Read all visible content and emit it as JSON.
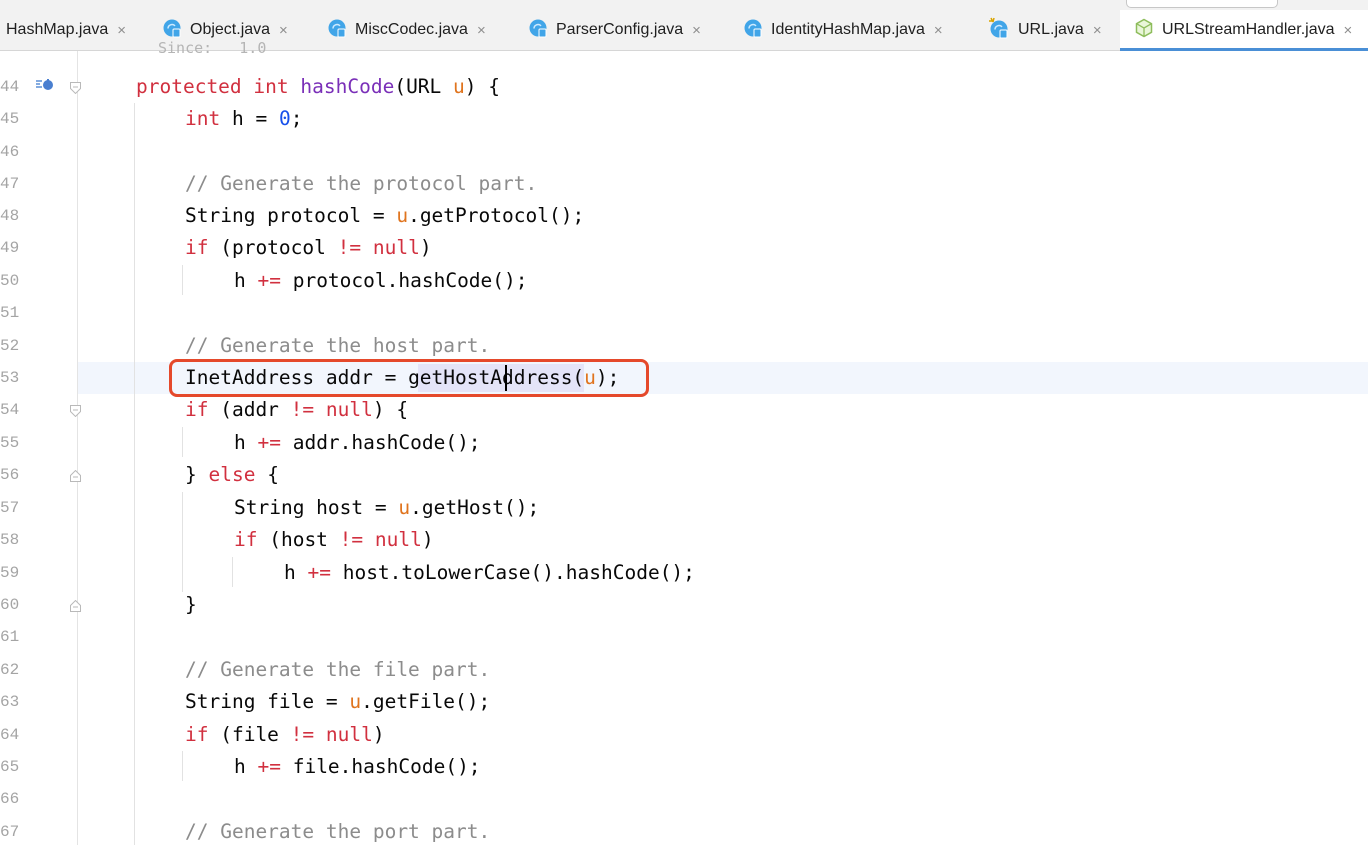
{
  "tabs": [
    {
      "label": "HashMap.java",
      "icon": "java-class-icon"
    },
    {
      "label": "Object.java",
      "icon": "java-class-icon"
    },
    {
      "label": "MiscCodec.java",
      "icon": "java-class-icon"
    },
    {
      "label": "ParserConfig.java",
      "icon": "java-class-icon"
    },
    {
      "label": "IdentityHashMap.java",
      "icon": "java-class-icon"
    },
    {
      "label": "URL.java",
      "icon": "java-final-class-icon"
    },
    {
      "label": "URLStreamHandler.java",
      "icon": "java-abstract-class-icon",
      "active": true
    }
  ],
  "close_glyph": "×",
  "partial_top_text": "Since:   1.0",
  "line_numbers": [
    "44",
    "45",
    "46",
    "47",
    "48",
    "49",
    "50",
    "51",
    "52",
    "53",
    "54",
    "55",
    "56",
    "57",
    "58",
    "59",
    "60",
    "61",
    "62",
    "63",
    "64",
    "65",
    "66",
    "67"
  ],
  "code": {
    "l44": {
      "kw": "protected",
      "type": "int",
      "name": "hashCode",
      "pre_param": "(URL ",
      "param": "u",
      "post": ") {"
    },
    "l45": {
      "type": "int",
      "mid": " h = ",
      "num": "0",
      "post": ";"
    },
    "l47": "// Generate the protocol part.",
    "l48": {
      "a": "String protocol = ",
      "p": "u",
      "b": ".getProtocol();"
    },
    "l49": {
      "kw": "if",
      "a": " (protocol ",
      "op": "!=",
      "b": " ",
      "null": "null",
      "c": ")"
    },
    "l50": {
      "a": "h ",
      "op": "+=",
      "b": " protocol.hashCode();"
    },
    "l52": "// Generate the host part.",
    "l53": {
      "a": "InetAddress addr = ",
      "sel1": "getHost",
      "sel2": "Address(",
      "p": "u",
      "b": ");"
    },
    "l54": {
      "kw": "if",
      "a": " (addr ",
      "op": "!=",
      "b": " ",
      "null": "null",
      "c": ") {"
    },
    "l55": {
      "a": "h ",
      "op": "+=",
      "b": " addr.hashCode();"
    },
    "l56": {
      "a": "} ",
      "kw": "else",
      "b": " {"
    },
    "l57": {
      "a": "String host = ",
      "p": "u",
      "b": ".getHost();"
    },
    "l58": {
      "kw": "if",
      "a": " (host ",
      "op": "!=",
      "b": " ",
      "null": "null",
      "c": ")"
    },
    "l59": {
      "a": "h ",
      "op": "+=",
      "b": " host.toLowerCase().hashCode();"
    },
    "l60": "}",
    "l62": "// Generate the file part.",
    "l63": {
      "a": "String file = ",
      "p": "u",
      "b": ".getFile();"
    },
    "l64": {
      "kw": "if",
      "a": " (file ",
      "op": "!=",
      "b": " ",
      "null": "null",
      "c": ")"
    },
    "l65": {
      "a": "h ",
      "op": "+=",
      "b": " file.hashCode();"
    },
    "l67": "// Generate the port part."
  },
  "colors": {
    "keyword": "#d1303f",
    "param": "#e0741e",
    "number": "#1750eb",
    "method_decl": "#7a2fb8",
    "comment": "#8c8c8c",
    "highlight_box": "#e5492b",
    "active_tab_underline": "#4a8fd6"
  },
  "gutter_icons": {
    "l44": "overriding-method-icon"
  }
}
